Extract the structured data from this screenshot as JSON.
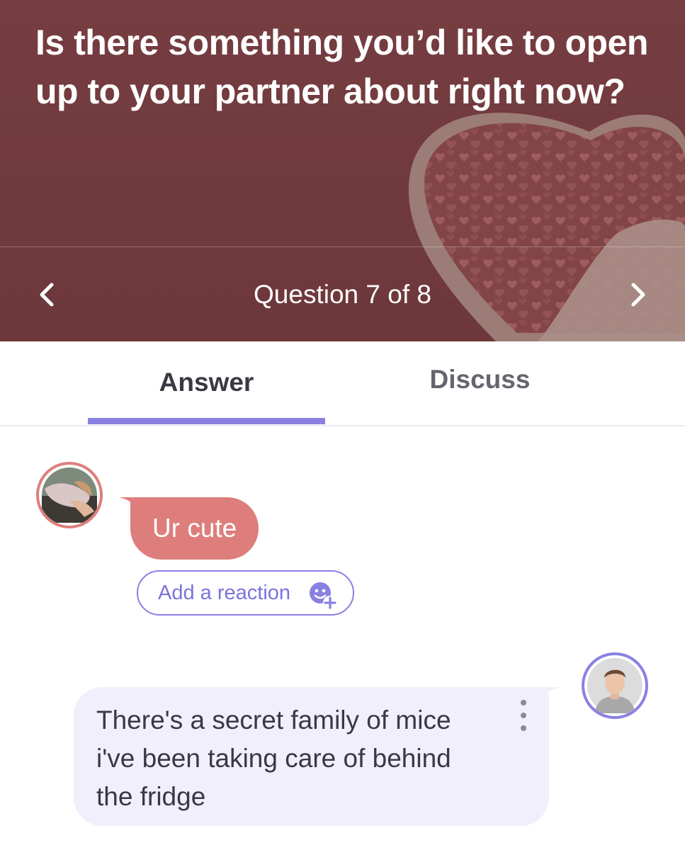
{
  "question": {
    "title": "Is there something you’d like to open up to your partner about right now?",
    "counter": "Question 7 of 8",
    "prev_icon": "chevron-left-icon",
    "next_icon": "chevron-right-icon"
  },
  "tabs": [
    {
      "label": "Answer",
      "selected": true
    },
    {
      "label": "Discuss",
      "selected": false
    }
  ],
  "conversation": {
    "partner_message": "Ur cute",
    "reaction_button_label": "Add a reaction",
    "reaction_icon": "add-emoji-icon",
    "my_message": "There's a secret family of mice i've been taking care of behind the fridge",
    "more_icon": "more-vertical-icon"
  },
  "colors": {
    "header_bg": "#713a3e",
    "accent": "#8a80e2",
    "partner_bubble": "#de7e7c",
    "my_bubble": "#f1effc"
  }
}
